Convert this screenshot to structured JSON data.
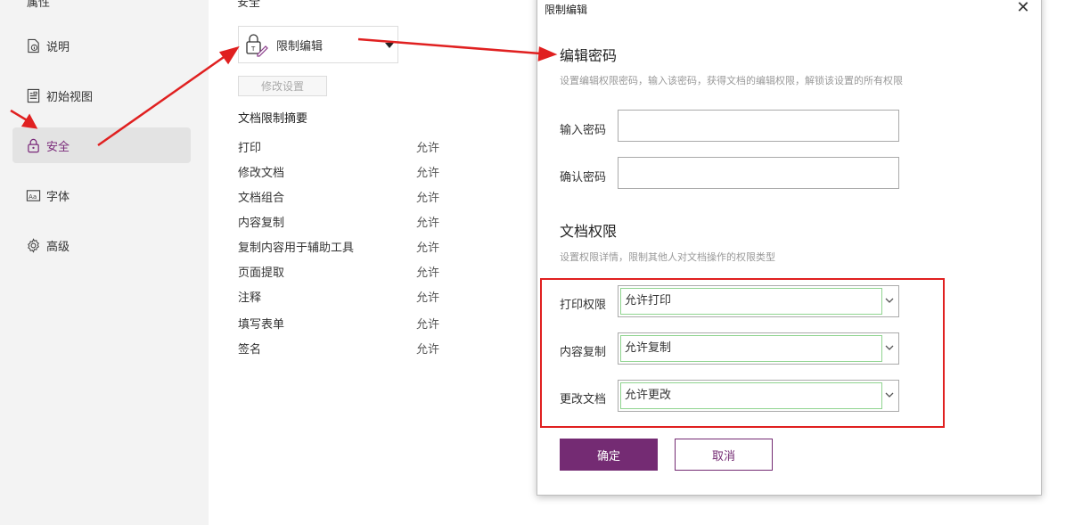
{
  "sidebar": {
    "top_label": "属性",
    "items": [
      {
        "label": "说明",
        "icon": "info-doc-icon"
      },
      {
        "label": "初始视图",
        "icon": "initial-view-icon"
      },
      {
        "label": "安全",
        "icon": "lock-icon",
        "active": true
      },
      {
        "label": "字体",
        "icon": "font-icon"
      },
      {
        "label": "高级",
        "icon": "gear-icon"
      }
    ]
  },
  "main": {
    "top_label": "安全",
    "restrict_label": "限制编辑",
    "modify_button": "修改设置",
    "summary_title": "文档限制摘要",
    "summary": [
      {
        "name": "打印",
        "value": "允许"
      },
      {
        "name": "修改文档",
        "value": "允许"
      },
      {
        "name": "文档组合",
        "value": "允许"
      },
      {
        "name": "内容复制",
        "value": "允许"
      },
      {
        "name": "复制内容用于辅助工具",
        "value": "允许"
      },
      {
        "name": "页面提取",
        "value": "允许"
      },
      {
        "name": "注释",
        "value": "允许"
      },
      {
        "name": "填写表单",
        "value": "允许"
      },
      {
        "name": "签名",
        "value": "允许"
      }
    ]
  },
  "dialog": {
    "title": "限制编辑",
    "section1_title": "编辑密码",
    "section1_desc": "设置编辑权限密码，输入该密码，获得文档的编辑权限，解锁该设置的所有权限",
    "password_label": "输入密码",
    "password_value": "",
    "confirm_label": "确认密码",
    "confirm_value": "",
    "section2_title": "文档权限",
    "section2_desc": "设置权限详情，限制其他人对文档操作的权限类型",
    "permissions": [
      {
        "label": "打印权限",
        "value": "允许打印"
      },
      {
        "label": "内容复制",
        "value": "允许复制"
      },
      {
        "label": "更改文档",
        "value": "允许更改"
      }
    ],
    "ok_label": "确定",
    "cancel_label": "取消"
  },
  "colors": {
    "accent": "#742b73",
    "annotation_red": "#e02020"
  }
}
